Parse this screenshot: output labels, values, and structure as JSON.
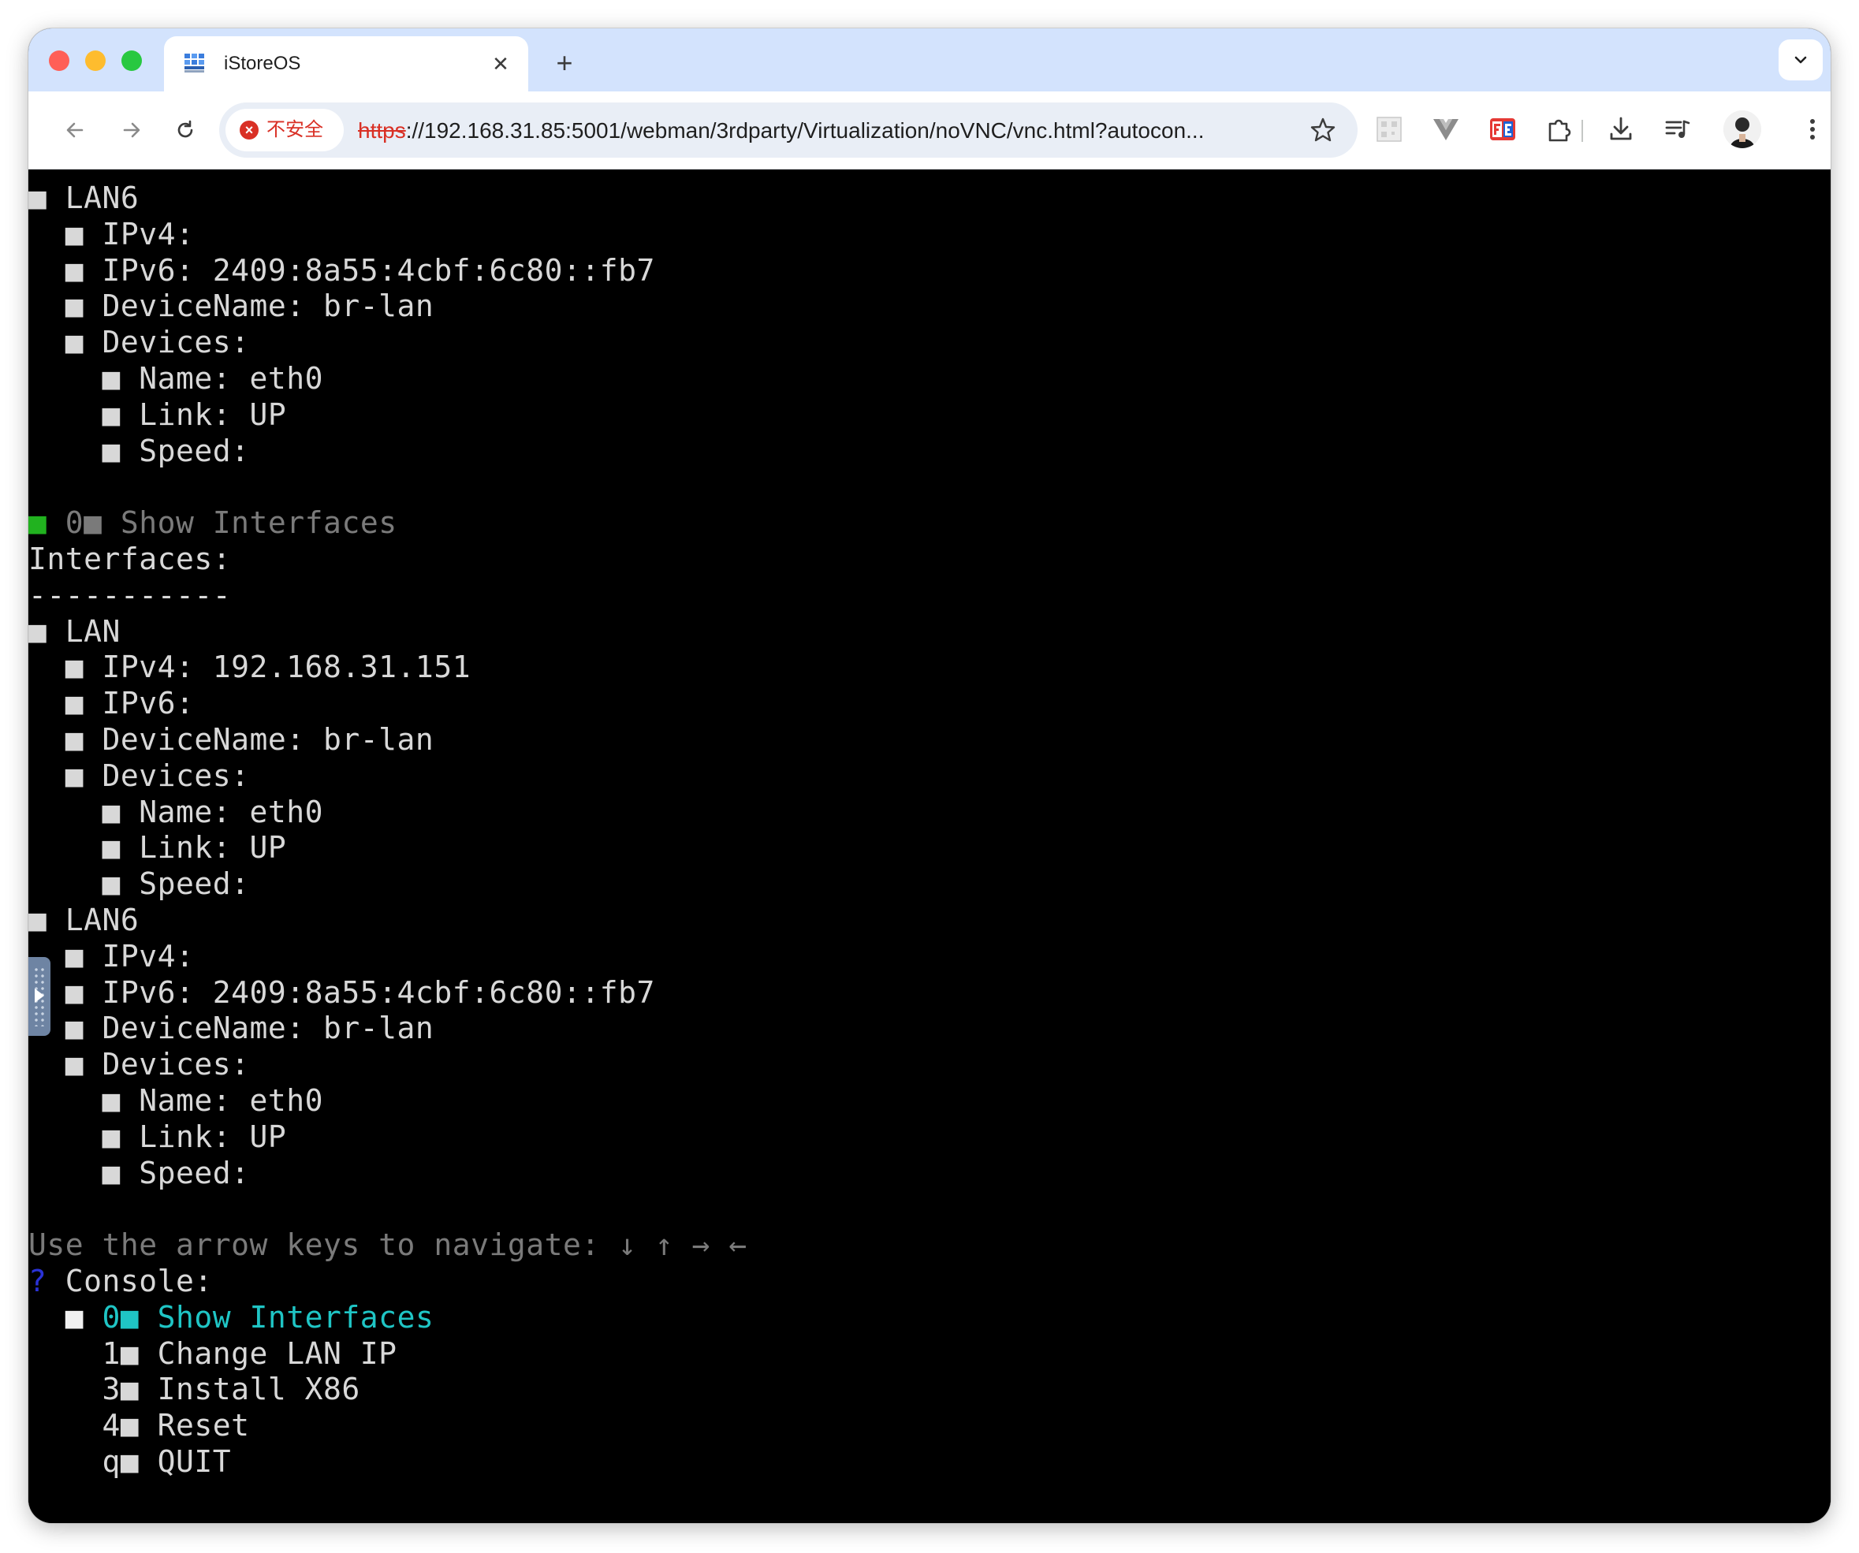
{
  "browser": {
    "tab_title": "iStoreOS",
    "close_glyph": "✕",
    "new_tab_glyph": "+",
    "security_label": "不安全",
    "url_scheme": "https",
    "url_rest": "://192.168.31.85:5001/webman/3rdparty/Virtualization/noVNC/vnc.html?autocon...",
    "accent_color": "#d3e3fd",
    "insecure_color": "#d93025"
  },
  "terminal": {
    "lines": [
      [
        {
          "t": "■ LAN6"
        }
      ],
      [
        {
          "t": "  ■ IPv4:"
        }
      ],
      [
        {
          "t": "  ■ IPv6: 2409:8a55:4cbf:6c80::fb7"
        }
      ],
      [
        {
          "t": "  ■ DeviceName: br-lan"
        }
      ],
      [
        {
          "t": "  ■ Devices:"
        }
      ],
      [
        {
          "t": "    ■ Name: eth0"
        }
      ],
      [
        {
          "t": "    ■ Link: UP"
        }
      ],
      [
        {
          "t": "    ■ Speed:"
        }
      ],
      [
        {
          "t": ""
        }
      ],
      [
        {
          "t": "■",
          "c": "green"
        },
        {
          "t": " 0■ Show Interfaces",
          "c": "gray"
        }
      ],
      [
        {
          "t": "Interfaces:"
        }
      ],
      [
        {
          "t": "-----------"
        }
      ],
      [
        {
          "t": "■ LAN"
        }
      ],
      [
        {
          "t": "  ■ IPv4: 192.168.31.151"
        }
      ],
      [
        {
          "t": "  ■ IPv6:"
        }
      ],
      [
        {
          "t": "  ■ DeviceName: br-lan"
        }
      ],
      [
        {
          "t": "  ■ Devices:"
        }
      ],
      [
        {
          "t": "    ■ Name: eth0"
        }
      ],
      [
        {
          "t": "    ■ Link: UP"
        }
      ],
      [
        {
          "t": "    ■ Speed:"
        }
      ],
      [
        {
          "t": "■ LAN6"
        }
      ],
      [
        {
          "t": "  ■ IPv4:"
        }
      ],
      [
        {
          "t": "  ■ IPv6: 2409:8a55:4cbf:6c80::fb7"
        }
      ],
      [
        {
          "t": "  ■ DeviceName: br-lan"
        }
      ],
      [
        {
          "t": "  ■ Devices:"
        }
      ],
      [
        {
          "t": "    ■ Name: eth0"
        }
      ],
      [
        {
          "t": "    ■ Link: UP"
        }
      ],
      [
        {
          "t": "    ■ Speed:"
        }
      ],
      [
        {
          "t": ""
        }
      ],
      [
        {
          "t": "Use the arrow keys to navigate: ↓ ↑ → ←",
          "c": "gray"
        }
      ],
      [
        {
          "t": "?",
          "c": "blue"
        },
        {
          "t": " Console:"
        }
      ],
      [
        {
          "t": "  ■ ",
          "c": "white"
        },
        {
          "t": "0■ Show Interfaces",
          "c": "cyan"
        }
      ],
      [
        {
          "t": "    1■ Change LAN IP"
        }
      ],
      [
        {
          "t": "    3■ Install X86"
        }
      ],
      [
        {
          "t": "    4■ Reset"
        }
      ],
      [
        {
          "t": "    q■ QUIT"
        }
      ]
    ]
  }
}
